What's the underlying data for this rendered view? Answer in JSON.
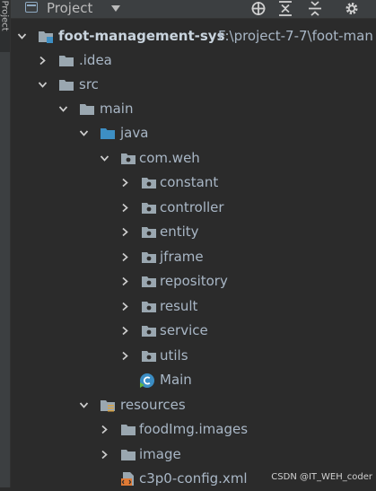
{
  "side_tab": {
    "label": "Project"
  },
  "toolbar": {
    "title": "Project",
    "icons": [
      "project-icon",
      "chevron-down-icon",
      "locate-icon",
      "expand-all-icon",
      "collapse-all-icon",
      "gear-icon"
    ]
  },
  "tree": {
    "root": {
      "label": "foot-management-sys",
      "path": "F:\\project-7-7\\foot-man"
    },
    "idea": {
      "label": ".idea"
    },
    "src": {
      "label": "src"
    },
    "main": {
      "label": "main"
    },
    "java": {
      "label": "java"
    },
    "pkg": {
      "label": "com.weh"
    },
    "constant": {
      "label": "constant"
    },
    "controller": {
      "label": "controller"
    },
    "entity": {
      "label": "entity"
    },
    "jframe": {
      "label": "jframe"
    },
    "repository": {
      "label": "repository"
    },
    "result": {
      "label": "result"
    },
    "service": {
      "label": "service"
    },
    "utils": {
      "label": "utils"
    },
    "mainclass": {
      "label": "Main"
    },
    "resources": {
      "label": "resources"
    },
    "foodimg": {
      "label": "foodImg.images"
    },
    "image": {
      "label": "image"
    },
    "c3p0": {
      "label": "c3p0-config.xml"
    }
  },
  "watermark": "CSDN @IT_WEH_coder",
  "colors": {
    "background": "#2b2b2b",
    "toolbar": "#3c3f41",
    "text": "#a9b7c6",
    "folder": "#9aa7b0",
    "source_folder": "#3d8fc4",
    "class_icon": "#3b8dc4"
  }
}
